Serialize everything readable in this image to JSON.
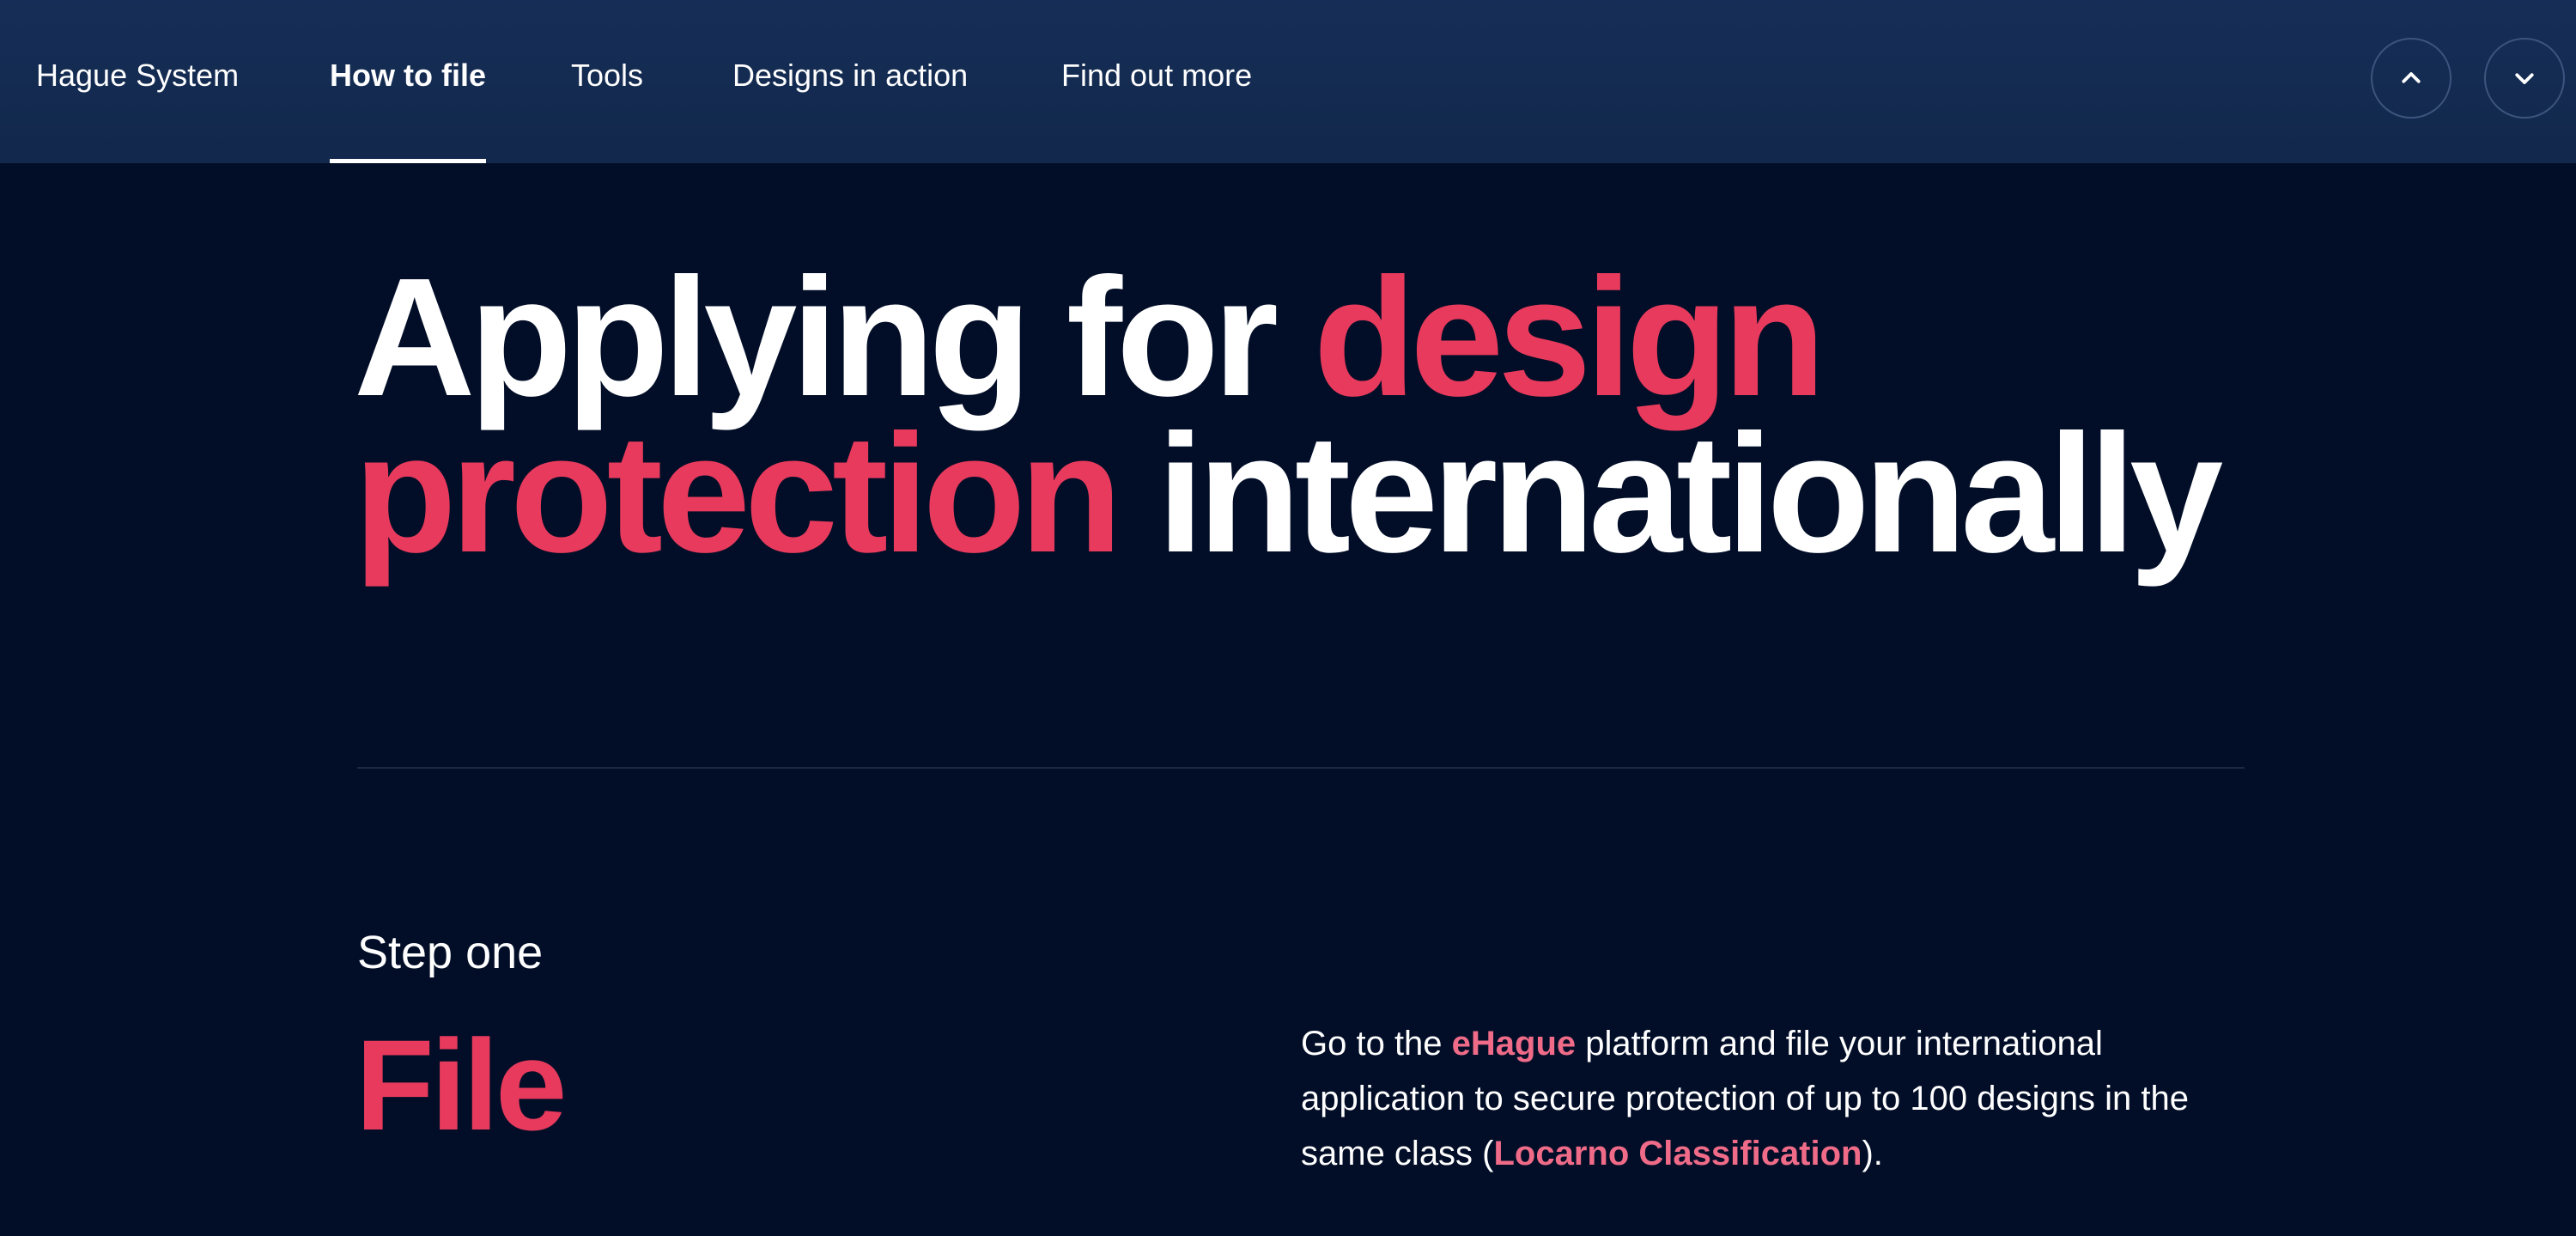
{
  "nav": {
    "items": [
      {
        "label": "Hague System",
        "active": false
      },
      {
        "label": "How to file",
        "active": true
      },
      {
        "label": "Tools",
        "active": false
      },
      {
        "label": "Designs in action",
        "active": false
      },
      {
        "label": "Find out more",
        "active": false
      }
    ],
    "prev_icon": "chevron-up-icon",
    "next_icon": "chevron-down-icon"
  },
  "hero": {
    "part1": "Applying for ",
    "accent": "design protection",
    "part2": " internationally"
  },
  "step": {
    "label": "Step one",
    "title": "File",
    "desc_before": "Go to the ",
    "link1": "eHague",
    "desc_middle": " platform and file your international application to secure protection of up to 100 designs in the same class (",
    "link2": "Locarno Classification",
    "desc_after": ")."
  },
  "colors": {
    "background": "#020e28",
    "header": "#14294f",
    "accent": "#e83a5c",
    "link": "#ef6b88"
  }
}
